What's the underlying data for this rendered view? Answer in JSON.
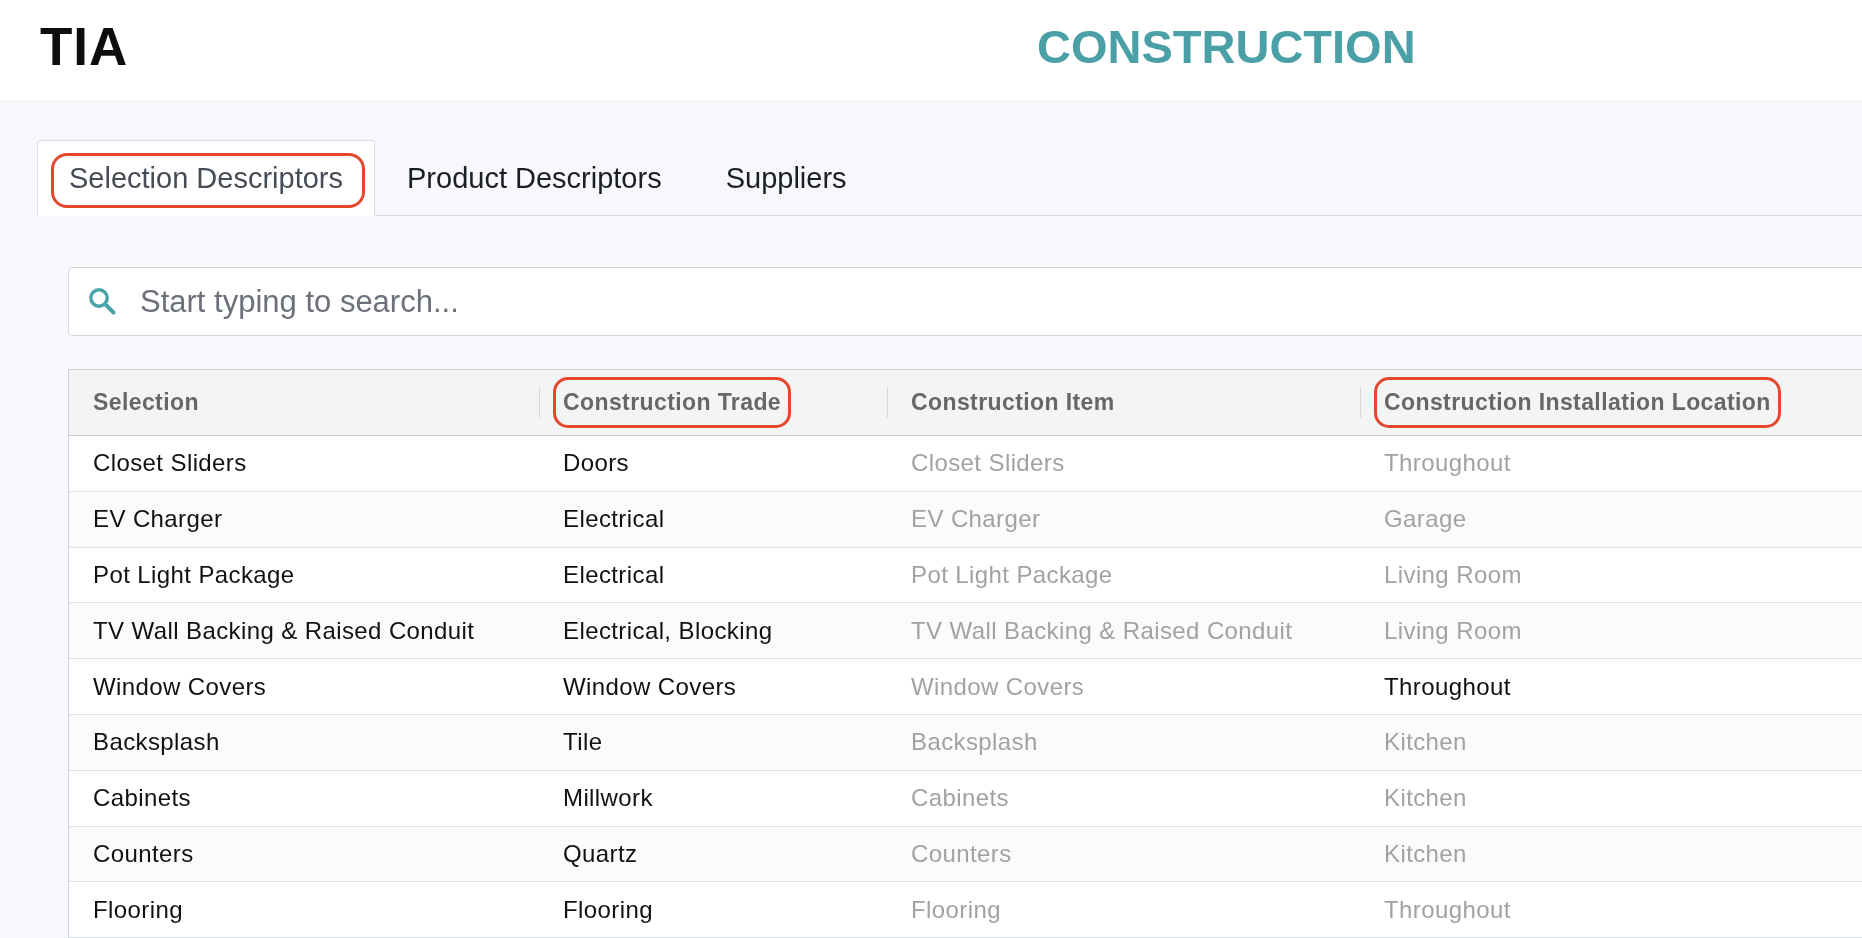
{
  "header": {
    "logo": "TIA",
    "title": "CONSTRUCTION"
  },
  "tabs": [
    {
      "label": "Selection Descriptors",
      "selected": true,
      "highlighted": true
    },
    {
      "label": "Product Descriptors",
      "selected": false,
      "highlighted": false
    },
    {
      "label": "Suppliers",
      "selected": false,
      "highlighted": false
    }
  ],
  "search": {
    "placeholder": "Start typing to search..."
  },
  "table": {
    "columns": [
      {
        "label": "Selection",
        "highlighted": false
      },
      {
        "label": "Construction Trade",
        "highlighted": true
      },
      {
        "label": "Construction Item",
        "highlighted": false
      },
      {
        "label": "Construction Installation Location",
        "highlighted": true
      }
    ],
    "rows": [
      {
        "cells": [
          {
            "text": "Closet Sliders",
            "muted": false
          },
          {
            "text": "Doors",
            "muted": false
          },
          {
            "text": "Closet Sliders",
            "muted": true
          },
          {
            "text": "Throughout",
            "muted": true
          }
        ]
      },
      {
        "cells": [
          {
            "text": "EV Charger",
            "muted": false
          },
          {
            "text": "Electrical",
            "muted": false
          },
          {
            "text": "EV Charger",
            "muted": true
          },
          {
            "text": "Garage",
            "muted": true
          }
        ]
      },
      {
        "cells": [
          {
            "text": "Pot Light Package",
            "muted": false
          },
          {
            "text": "Electrical",
            "muted": false
          },
          {
            "text": "Pot Light Package",
            "muted": true
          },
          {
            "text": "Living Room",
            "muted": true
          }
        ]
      },
      {
        "cells": [
          {
            "text": "TV Wall Backing & Raised Conduit",
            "muted": false
          },
          {
            "text": "Electrical, Blocking",
            "muted": false
          },
          {
            "text": "TV Wall Backing & Raised Conduit",
            "muted": true
          },
          {
            "text": "Living Room",
            "muted": true
          }
        ]
      },
      {
        "cells": [
          {
            "text": "Window Covers",
            "muted": false
          },
          {
            "text": "Window Covers",
            "muted": false
          },
          {
            "text": "Window Covers",
            "muted": true
          },
          {
            "text": "Throughout",
            "muted": false
          }
        ]
      },
      {
        "cells": [
          {
            "text": "Backsplash",
            "muted": false
          },
          {
            "text": "Tile",
            "muted": false
          },
          {
            "text": "Backsplash",
            "muted": true
          },
          {
            "text": "Kitchen",
            "muted": true
          }
        ]
      },
      {
        "cells": [
          {
            "text": "Cabinets",
            "muted": false
          },
          {
            "text": "Millwork",
            "muted": false
          },
          {
            "text": "Cabinets",
            "muted": true
          },
          {
            "text": "Kitchen",
            "muted": true
          }
        ]
      },
      {
        "cells": [
          {
            "text": "Counters",
            "muted": false
          },
          {
            "text": "Quartz",
            "muted": false
          },
          {
            "text": "Counters",
            "muted": true
          },
          {
            "text": "Kitchen",
            "muted": true
          }
        ]
      },
      {
        "cells": [
          {
            "text": "Flooring",
            "muted": false
          },
          {
            "text": "Flooring",
            "muted": false
          },
          {
            "text": "Flooring",
            "muted": true
          },
          {
            "text": "Throughout",
            "muted": true
          }
        ]
      }
    ]
  }
}
